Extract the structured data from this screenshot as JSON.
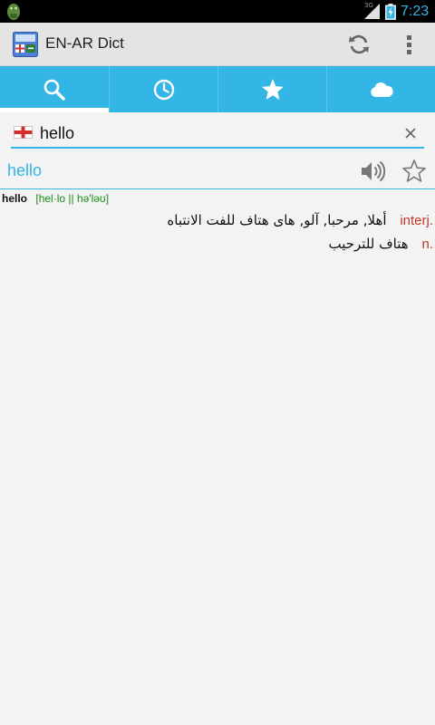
{
  "status_bar": {
    "time": "7:23",
    "network": "3G",
    "icons": [
      "android-icon",
      "signal-icon",
      "battery-icon"
    ]
  },
  "action_bar": {
    "title": "EN-AR Dict",
    "icons": [
      "app-icon",
      "refresh-icon",
      "overflow-menu-icon"
    ]
  },
  "tabs": [
    {
      "icon": "search-icon",
      "active": true
    },
    {
      "icon": "history-icon",
      "active": false
    },
    {
      "icon": "favorites-star-icon",
      "active": false
    },
    {
      "icon": "cloud-icon",
      "active": false
    }
  ],
  "search": {
    "flag": "england-flag-icon",
    "value": "hello",
    "clear_icon": "clear-icon"
  },
  "result": {
    "word": "hello",
    "icons": [
      "speaker-icon",
      "star-outline-icon"
    ]
  },
  "definition": {
    "headword": "hello",
    "pronunciation": "[hel·lo || hə'ləʊ]",
    "senses": [
      {
        "pos": "interj.",
        "arabic": "أهلا, مرحبا, آلو, هاى هتاف للفت الانتباه"
      },
      {
        "pos": "n.",
        "arabic": "هتاف للترحيب"
      }
    ]
  },
  "colors": {
    "accent": "#33b5e5",
    "pos": "#c0392b",
    "pronunciation": "#1a8c1a",
    "background": "#f3f3f3",
    "action_bar": "#e4e4e4"
  }
}
